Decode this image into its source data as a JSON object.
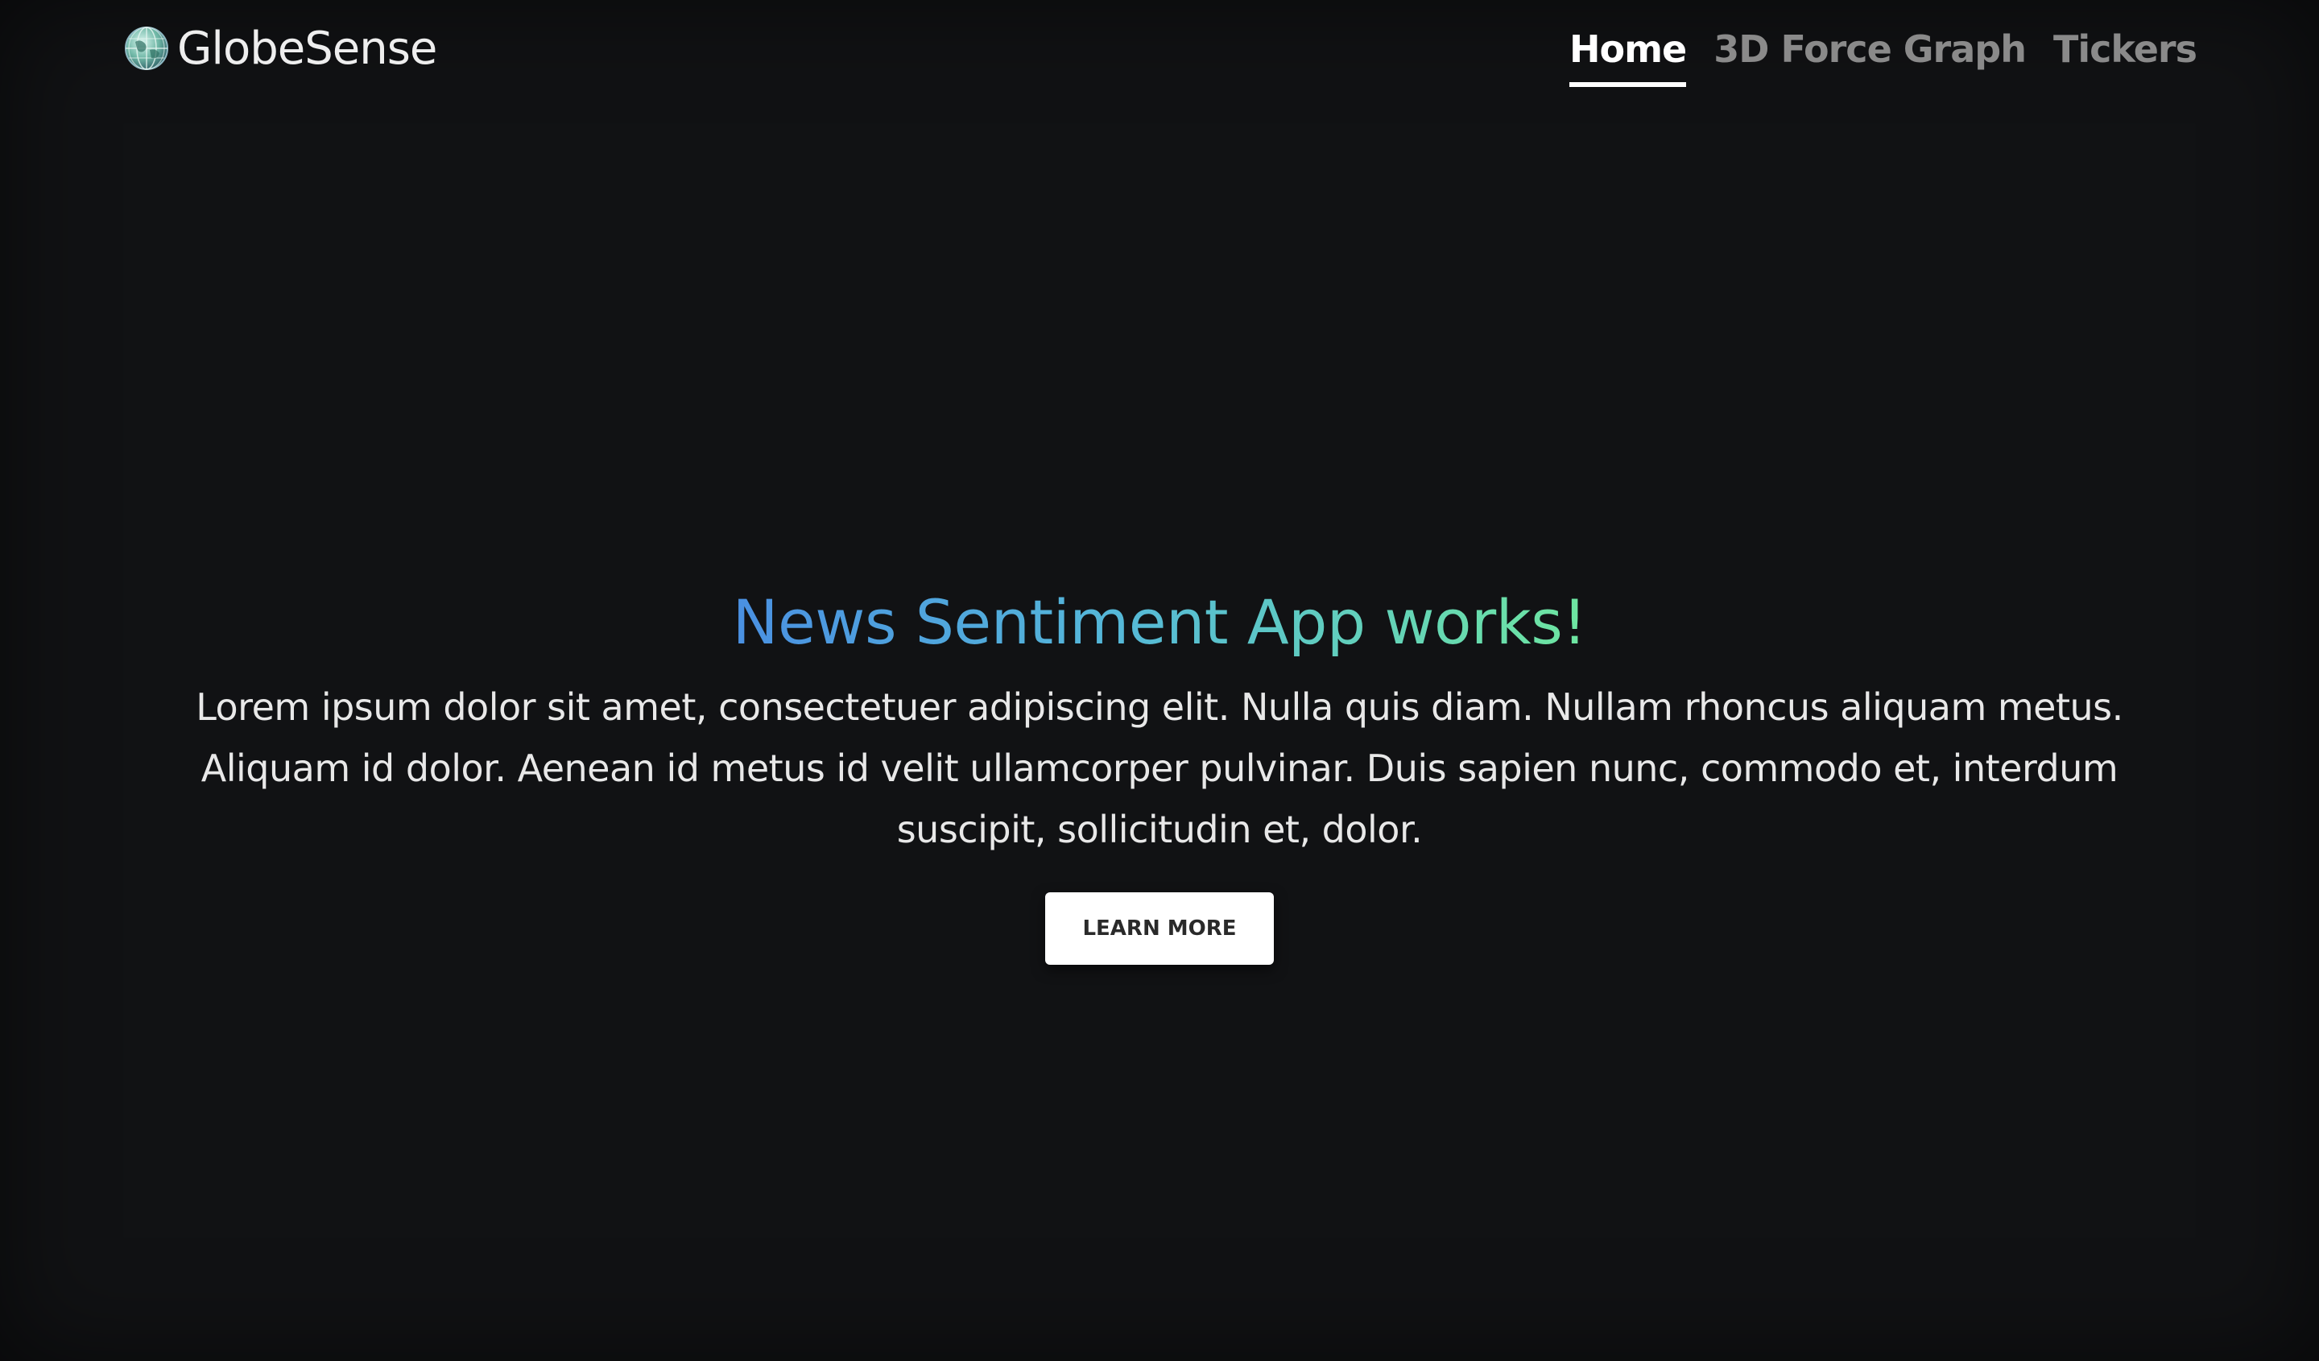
{
  "brand": {
    "name": "GlobeSense",
    "icon": "globe-icon"
  },
  "nav": {
    "items": [
      {
        "label": "Home",
        "active": true
      },
      {
        "label": "3D Force Graph",
        "active": false
      },
      {
        "label": "Tickers",
        "active": false
      }
    ]
  },
  "hero": {
    "title": "News Sentiment App works!",
    "body": "Lorem ipsum dolor sit amet, consectetuer adipiscing elit. Nulla quis diam. Nullam rhoncus aliquam metus. Aliquam id dolor. Aenean id metus id velit ullamcorper pulvinar. Duis sapien nunc, commodo et, interdum suscipit, sollicitudin et, dolor.",
    "button_label": "LEARN MORE"
  },
  "colors": {
    "background": "#111214",
    "title_gradient_start": "#4a90e2",
    "title_gradient_end": "#6ee6a0",
    "nav_active": "#ffffff",
    "nav_inactive": "#8a8a8a"
  }
}
